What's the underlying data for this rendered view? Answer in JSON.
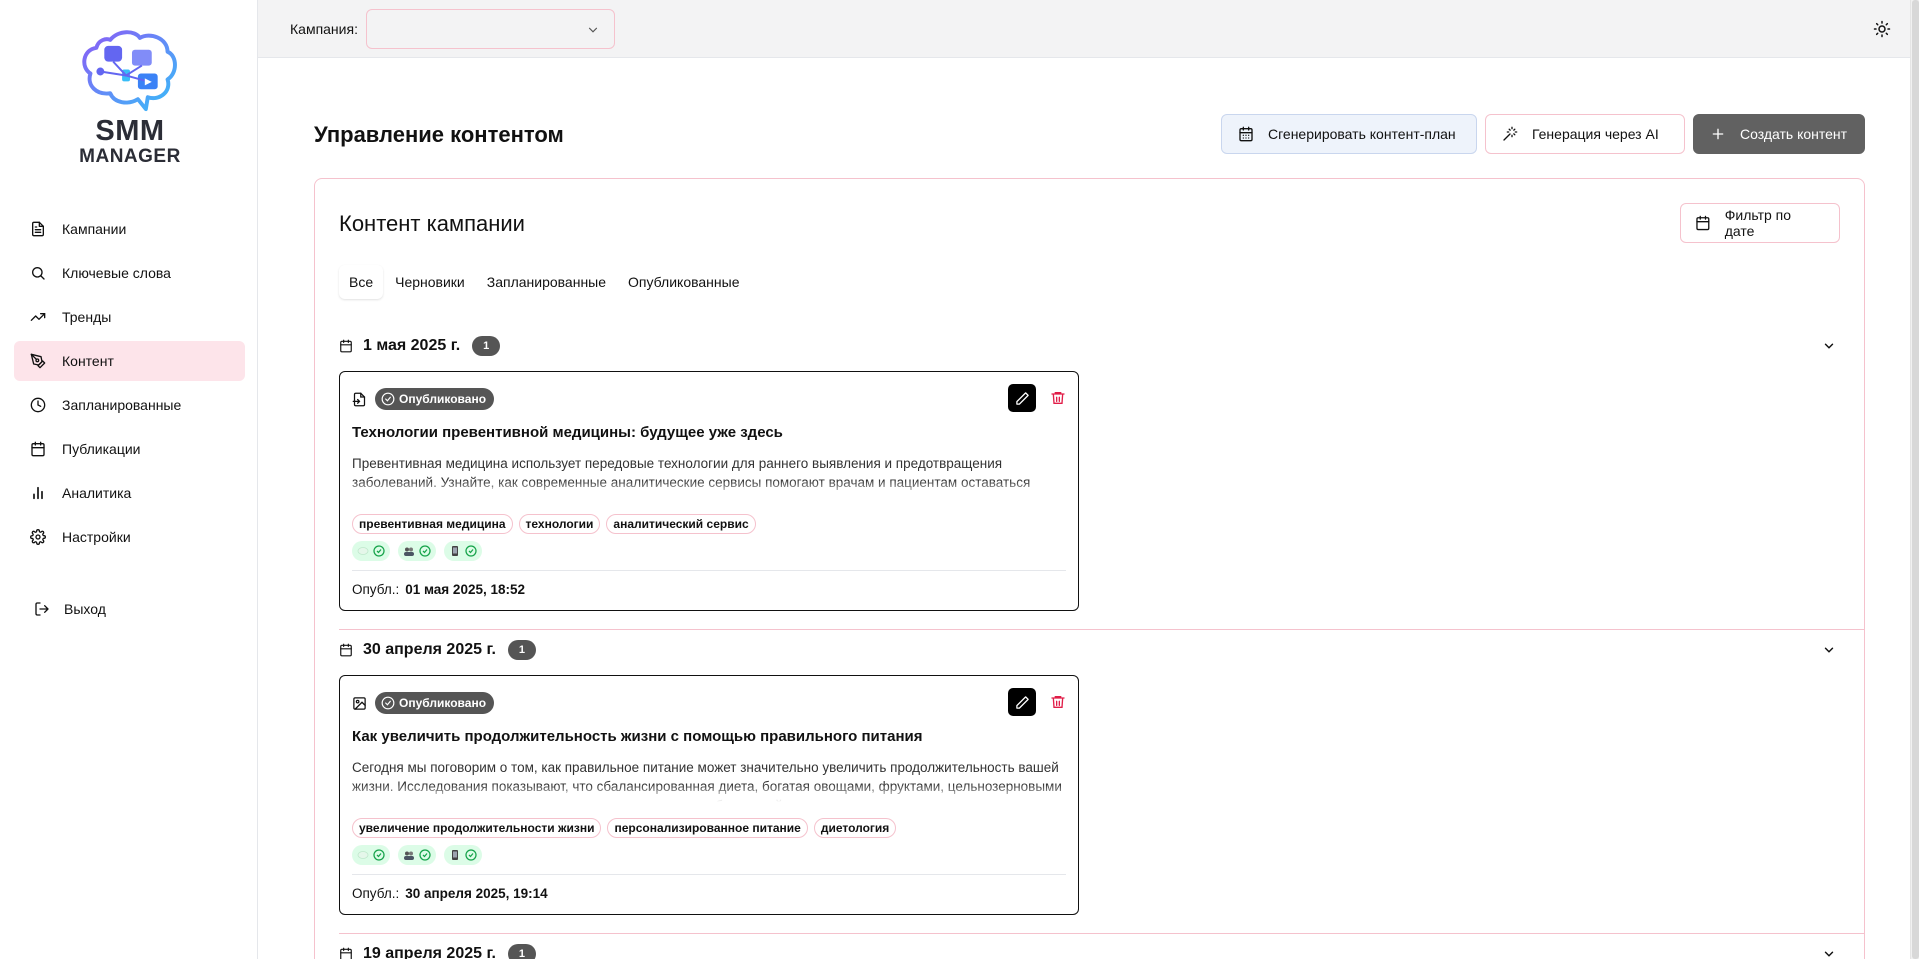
{
  "app": {
    "logo_line1": "SMM",
    "logo_line2": "MANAGER",
    "brand_color": "#6c5ce7",
    "accent_color": "#fde4ea",
    "border_color": "#f5c2cd"
  },
  "sidebar": {
    "items": [
      {
        "label": "Кампании",
        "icon": "file-text-icon"
      },
      {
        "label": "Ключевые слова",
        "icon": "search-icon"
      },
      {
        "label": "Тренды",
        "icon": "trending-up-icon"
      },
      {
        "label": "Контент",
        "icon": "pen-tool-icon",
        "active": true
      },
      {
        "label": "Запланированные",
        "icon": "clock-icon"
      },
      {
        "label": "Публикации",
        "icon": "calendar-icon"
      },
      {
        "label": "Аналитика",
        "icon": "bar-chart-icon"
      },
      {
        "label": "Настройки",
        "icon": "gear-icon"
      }
    ],
    "logout_label": "Выход"
  },
  "topbar": {
    "campaign_label": "Кампания:",
    "campaign_value": ""
  },
  "page": {
    "title": "Управление контентом",
    "btn_plan": "Сгенерировать контент-план",
    "btn_ai": "Генерация через AI",
    "btn_create": "Создать контент"
  },
  "content_card": {
    "title": "Контент кампании",
    "filter_label": "Фильтр по дате",
    "tabs": [
      "Все",
      "Черновики",
      "Запланированные",
      "Опубликованные"
    ],
    "active_tab": "Все"
  },
  "groups": [
    {
      "date": "1 мая 2025 г.",
      "count": "1",
      "posts": [
        {
          "type_icon": "file-text-icon",
          "status": "Опубликовано",
          "title": "Технологии превентивной медицины: будущее уже здесь",
          "text": "Превентивная медицина использует передовые технологии для раннего выявления и предотвращения заболеваний. Узнайте, как современные аналитические сервисы помогают врачам и пациентам оставаться здоровыми...",
          "tags": [
            "превентивная медицина",
            "технологии",
            "аналитический сервис"
          ],
          "published_label": "Опубл.:",
          "published_at": "01 мая 2025, 18:52"
        }
      ]
    },
    {
      "date": "30 апреля 2025 г.",
      "count": "1",
      "posts": [
        {
          "type_icon": "image-icon",
          "status": "Опубликовано",
          "title": "Как увеличить продолжительность жизни с помощью правильного питания",
          "text": "Сегодня мы поговорим о том, как правильное питание может значительно увеличить продолжительность вашей жизни. Исследования показывают, что сбалансированная диета, богатая овощами, фруктами, цельнозерновыми и здоровыми жирами, может снизить риск хронических заболеваний.",
          "tags": [
            "увеличение продолжительности жизни",
            "персонализированное питание",
            "диетология"
          ],
          "published_label": "Опубл.:",
          "published_at": "30 апреля 2025, 19:14"
        }
      ]
    },
    {
      "date": "19 апреля 2025 г.",
      "count": "1",
      "posts": []
    }
  ]
}
